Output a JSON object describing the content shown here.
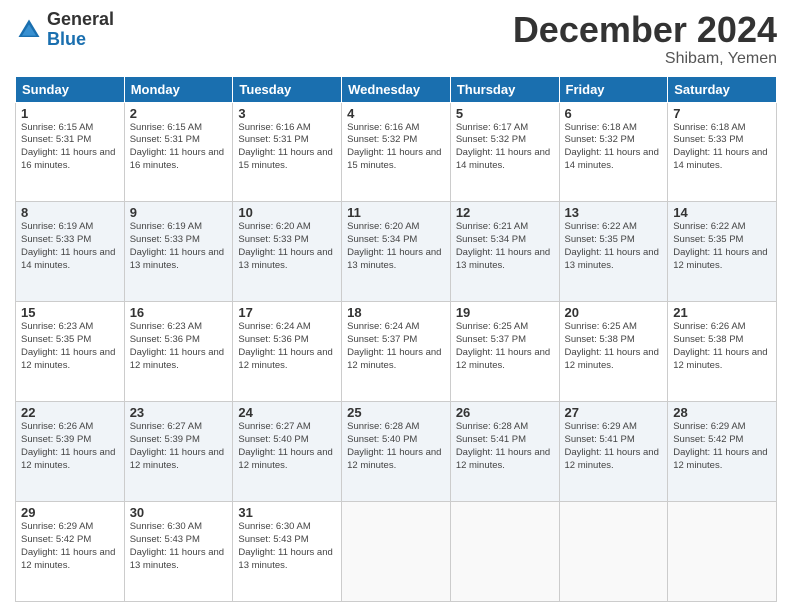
{
  "logo": {
    "general": "General",
    "blue": "Blue"
  },
  "header": {
    "month": "December 2024",
    "location": "Shibam, Yemen"
  },
  "weekdays": [
    "Sunday",
    "Monday",
    "Tuesday",
    "Wednesday",
    "Thursday",
    "Friday",
    "Saturday"
  ],
  "weeks": [
    [
      {
        "day": "1",
        "sunrise": "6:15 AM",
        "sunset": "5:31 PM",
        "daylight": "11 hours and 16 minutes."
      },
      {
        "day": "2",
        "sunrise": "6:15 AM",
        "sunset": "5:31 PM",
        "daylight": "11 hours and 16 minutes."
      },
      {
        "day": "3",
        "sunrise": "6:16 AM",
        "sunset": "5:31 PM",
        "daylight": "11 hours and 15 minutes."
      },
      {
        "day": "4",
        "sunrise": "6:16 AM",
        "sunset": "5:32 PM",
        "daylight": "11 hours and 15 minutes."
      },
      {
        "day": "5",
        "sunrise": "6:17 AM",
        "sunset": "5:32 PM",
        "daylight": "11 hours and 14 minutes."
      },
      {
        "day": "6",
        "sunrise": "6:18 AM",
        "sunset": "5:32 PM",
        "daylight": "11 hours and 14 minutes."
      },
      {
        "day": "7",
        "sunrise": "6:18 AM",
        "sunset": "5:33 PM",
        "daylight": "11 hours and 14 minutes."
      }
    ],
    [
      {
        "day": "8",
        "sunrise": "6:19 AM",
        "sunset": "5:33 PM",
        "daylight": "11 hours and 14 minutes."
      },
      {
        "day": "9",
        "sunrise": "6:19 AM",
        "sunset": "5:33 PM",
        "daylight": "11 hours and 13 minutes."
      },
      {
        "day": "10",
        "sunrise": "6:20 AM",
        "sunset": "5:33 PM",
        "daylight": "11 hours and 13 minutes."
      },
      {
        "day": "11",
        "sunrise": "6:20 AM",
        "sunset": "5:34 PM",
        "daylight": "11 hours and 13 minutes."
      },
      {
        "day": "12",
        "sunrise": "6:21 AM",
        "sunset": "5:34 PM",
        "daylight": "11 hours and 13 minutes."
      },
      {
        "day": "13",
        "sunrise": "6:22 AM",
        "sunset": "5:35 PM",
        "daylight": "11 hours and 13 minutes."
      },
      {
        "day": "14",
        "sunrise": "6:22 AM",
        "sunset": "5:35 PM",
        "daylight": "11 hours and 12 minutes."
      }
    ],
    [
      {
        "day": "15",
        "sunrise": "6:23 AM",
        "sunset": "5:35 PM",
        "daylight": "11 hours and 12 minutes."
      },
      {
        "day": "16",
        "sunrise": "6:23 AM",
        "sunset": "5:36 PM",
        "daylight": "11 hours and 12 minutes."
      },
      {
        "day": "17",
        "sunrise": "6:24 AM",
        "sunset": "5:36 PM",
        "daylight": "11 hours and 12 minutes."
      },
      {
        "day": "18",
        "sunrise": "6:24 AM",
        "sunset": "5:37 PM",
        "daylight": "11 hours and 12 minutes."
      },
      {
        "day": "19",
        "sunrise": "6:25 AM",
        "sunset": "5:37 PM",
        "daylight": "11 hours and 12 minutes."
      },
      {
        "day": "20",
        "sunrise": "6:25 AM",
        "sunset": "5:38 PM",
        "daylight": "11 hours and 12 minutes."
      },
      {
        "day": "21",
        "sunrise": "6:26 AM",
        "sunset": "5:38 PM",
        "daylight": "11 hours and 12 minutes."
      }
    ],
    [
      {
        "day": "22",
        "sunrise": "6:26 AM",
        "sunset": "5:39 PM",
        "daylight": "11 hours and 12 minutes."
      },
      {
        "day": "23",
        "sunrise": "6:27 AM",
        "sunset": "5:39 PM",
        "daylight": "11 hours and 12 minutes."
      },
      {
        "day": "24",
        "sunrise": "6:27 AM",
        "sunset": "5:40 PM",
        "daylight": "11 hours and 12 minutes."
      },
      {
        "day": "25",
        "sunrise": "6:28 AM",
        "sunset": "5:40 PM",
        "daylight": "11 hours and 12 minutes."
      },
      {
        "day": "26",
        "sunrise": "6:28 AM",
        "sunset": "5:41 PM",
        "daylight": "11 hours and 12 minutes."
      },
      {
        "day": "27",
        "sunrise": "6:29 AM",
        "sunset": "5:41 PM",
        "daylight": "11 hours and 12 minutes."
      },
      {
        "day": "28",
        "sunrise": "6:29 AM",
        "sunset": "5:42 PM",
        "daylight": "11 hours and 12 minutes."
      }
    ],
    [
      {
        "day": "29",
        "sunrise": "6:29 AM",
        "sunset": "5:42 PM",
        "daylight": "11 hours and 12 minutes."
      },
      {
        "day": "30",
        "sunrise": "6:30 AM",
        "sunset": "5:43 PM",
        "daylight": "11 hours and 13 minutes."
      },
      {
        "day": "31",
        "sunrise": "6:30 AM",
        "sunset": "5:43 PM",
        "daylight": "11 hours and 13 minutes."
      },
      null,
      null,
      null,
      null
    ]
  ]
}
